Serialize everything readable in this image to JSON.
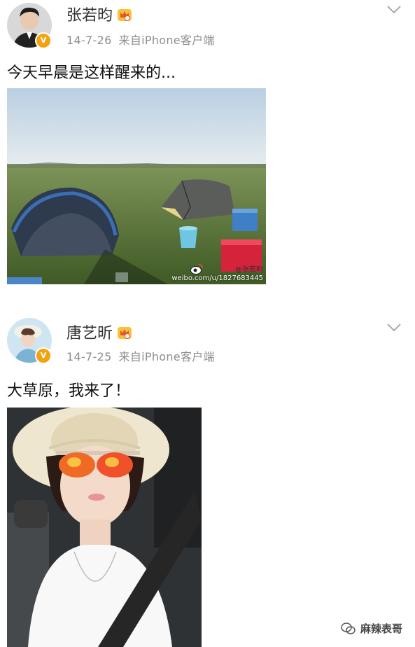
{
  "posts": [
    {
      "username": "张若昀",
      "date": "14-7-26",
      "source": "来自iPhone客户端",
      "text": "今天早晨是这样醒来的...",
      "photo_watermark_name": "@张若昀",
      "photo_watermark_url": "weibo.com/u/1827683445",
      "verified_badge": "V"
    },
    {
      "username": "唐艺昕",
      "date": "14-7-25",
      "source": "来自iPhone客户端",
      "text": "大草原，我来了！",
      "verified_badge": "V"
    }
  ],
  "watermark": {
    "label": "麻辣表哥"
  },
  "colors": {
    "badge": "#f2a30f",
    "meta_text": "#8e8e8e",
    "sky": "#c9dcea",
    "grass": "#5e7a36"
  },
  "icons": [
    "chevron-down-icon",
    "crown-icon",
    "verified-badge-icon",
    "weibo-logo-icon",
    "wechat-icon"
  ]
}
